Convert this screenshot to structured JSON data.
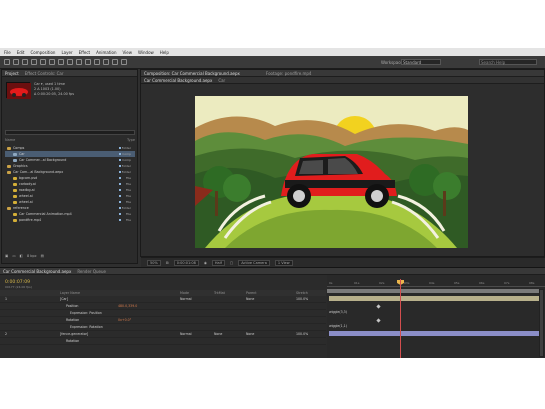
{
  "menubar": {
    "items": [
      "File",
      "Edit",
      "Composition",
      "Layer",
      "Effect",
      "Animation",
      "View",
      "Window",
      "Help"
    ]
  },
  "toolbar": {
    "workspace_label": "Workspace:",
    "workspace_value": "Standard",
    "search_placeholder": "Search Help"
  },
  "project_panel": {
    "tabs": [
      "Project",
      "Effect Controls: Car"
    ],
    "info": [
      "Car ▾, used 1 time",
      "2 Δ 1003 (1.00)",
      "Δ 0:00:20:05, 24.00 fps"
    ],
    "column_header_name": "Name",
    "column_header_type": "Type",
    "items": [
      {
        "label": "Comps",
        "kind": "folder",
        "type": "Folder"
      },
      {
        "label": "Car",
        "kind": "comp",
        "type": "Comp",
        "selected": true
      },
      {
        "label": "Car Commer...al Background",
        "kind": "comp",
        "type": "Comp"
      },
      {
        "label": "Graphics",
        "kind": "folder",
        "type": "Folder"
      },
      {
        "label": "Car Com...al Background.aepx",
        "kind": "folder",
        "type": "Folder"
      },
      {
        "label": "bgcom.psd",
        "kind": "img",
        "type": "File"
      },
      {
        "label": "carbody.ai",
        "kind": "img",
        "type": "File"
      },
      {
        "label": "roadbg.ai",
        "kind": "img",
        "type": "File"
      },
      {
        "label": "wheel.ai",
        "kind": "img",
        "type": "File"
      },
      {
        "label": "wheel.ai",
        "kind": "img",
        "type": "File"
      },
      {
        "label": "reference",
        "kind": "folder",
        "type": "Folder"
      },
      {
        "label": "Car Commercial Animation.mp4",
        "kind": "img",
        "type": "File"
      },
      {
        "label": "pondfire.mp4",
        "kind": "img",
        "type": "File"
      }
    ],
    "bottom_label": "8 bpc"
  },
  "comp_panel": {
    "tabs": [
      "Composition: Car Commercial Background.aepx",
      "Footage: pondfire.mp4"
    ],
    "subtabs": [
      "Car Commercial Background.aepx",
      "Car"
    ]
  },
  "viewer_bar": {
    "zoom": "50%",
    "timecode": "0:00:01:08",
    "resolution": "Half",
    "view": "Active Camera",
    "views": "1 View"
  },
  "timeline": {
    "tabs": [
      "Car Commercial Background.aepx",
      "Render Queue"
    ],
    "time": "0:00:07:09",
    "frames": "00177 (24.00 fps)",
    "col_name": "Layer Name",
    "col_mode": "Mode",
    "col_trkmat": "TrkMat",
    "col_parent": "Parent",
    "col_stretch": "Stretch",
    "layers": [
      {
        "num": "1",
        "name": "[Car]",
        "mode": "Normal",
        "parent": "None",
        "stretch": "100.0%"
      },
      {
        "name": "Position",
        "value": "480.0,339.0"
      },
      {
        "name": "Expression: Position"
      },
      {
        "name": "Rotation",
        "value": "0x+0.0°"
      },
      {
        "name": "Expression: Rotation"
      },
      {
        "num": "2",
        "name": "[fence-generator]",
        "mode": "Normal",
        "trkmat": "None",
        "parent": "None",
        "stretch": "100.0%"
      },
      {
        "name": "Rotation"
      }
    ],
    "expressions": [
      "wiggle(3,3)",
      "wiggle(1,1)"
    ],
    "ruler_ticks": [
      "0s",
      "01s",
      "02s",
      "03s",
      "04s",
      "05s",
      "06s",
      "07s",
      "08s"
    ]
  },
  "colors": {
    "app_bg": "#2f2f2f",
    "accent_time": "#d6b74a",
    "cti": "#d24e4e",
    "selected_row": "#4a5d73",
    "car_red": "#e31b1b"
  }
}
